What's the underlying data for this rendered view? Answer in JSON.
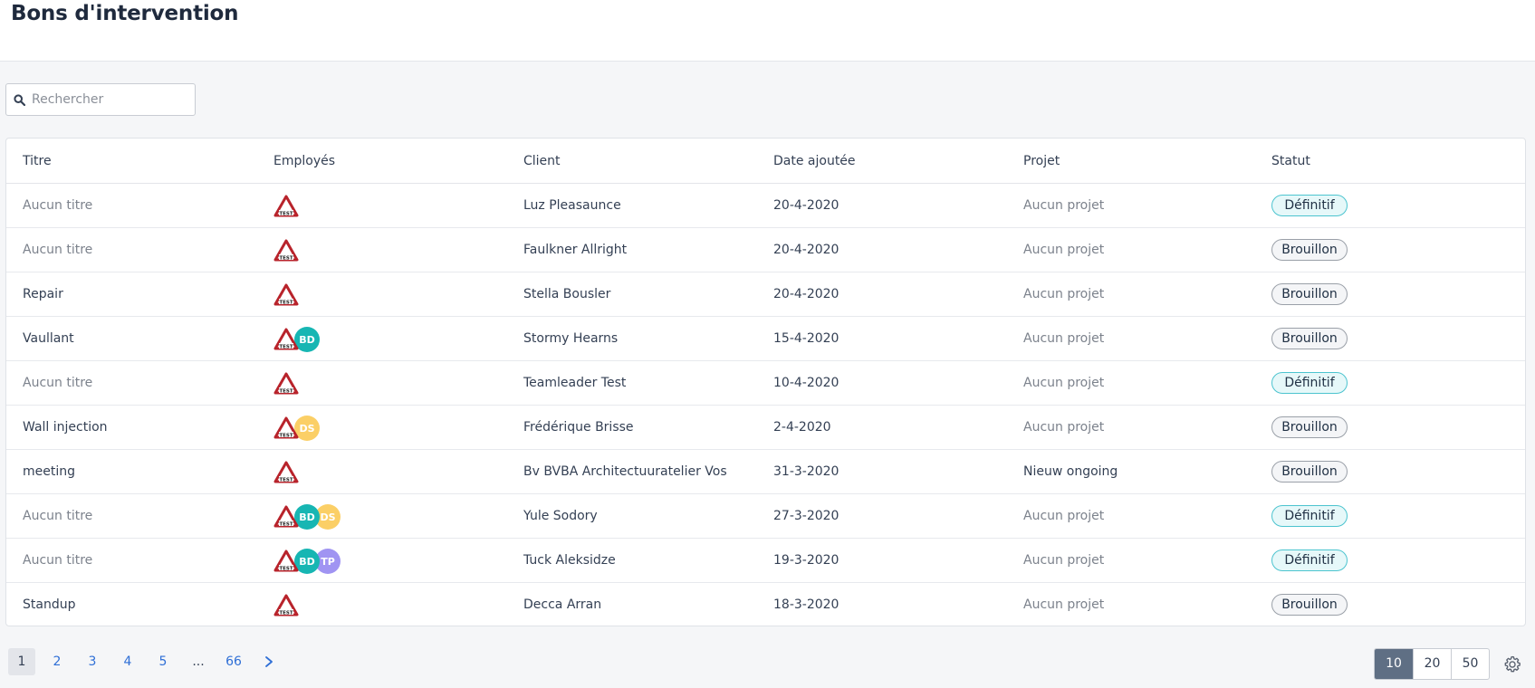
{
  "header": {
    "title": "Bons d'intervention"
  },
  "search": {
    "placeholder": "Rechercher",
    "icon": "search-icon"
  },
  "table": {
    "columns": [
      "Titre",
      "Employés",
      "Client",
      "Date ajoutée",
      "Projet",
      "Statut"
    ],
    "rows": [
      {
        "title": "Aucun titre",
        "title_muted": true,
        "employees": [
          "TEST"
        ],
        "client": "Luz Pleasaunce",
        "date": "20-4-2020",
        "project": "Aucun projet",
        "project_muted": true,
        "status": "Définitif",
        "status_kind": "def"
      },
      {
        "title": "Aucun titre",
        "title_muted": true,
        "employees": [
          "TEST"
        ],
        "client": "Faulkner Allright",
        "date": "20-4-2020",
        "project": "Aucun projet",
        "project_muted": true,
        "status": "Brouillon",
        "status_kind": "dra"
      },
      {
        "title": "Repair",
        "title_muted": false,
        "employees": [
          "TEST"
        ],
        "client": "Stella Bousler",
        "date": "20-4-2020",
        "project": "Aucun projet",
        "project_muted": true,
        "status": "Brouillon",
        "status_kind": "dra"
      },
      {
        "title": "Vaullant",
        "title_muted": false,
        "employees": [
          "TEST",
          "BD"
        ],
        "client": "Stormy Hearns",
        "date": "15-4-2020",
        "project": "Aucun projet",
        "project_muted": true,
        "status": "Brouillon",
        "status_kind": "dra"
      },
      {
        "title": "Aucun titre",
        "title_muted": true,
        "employees": [
          "TEST"
        ],
        "client": "Teamleader Test",
        "date": "10-4-2020",
        "project": "Aucun projet",
        "project_muted": true,
        "status": "Définitif",
        "status_kind": "def"
      },
      {
        "title": "Wall injection",
        "title_muted": false,
        "employees": [
          "TEST",
          "DS"
        ],
        "client": "Frédérique Brisse",
        "date": "2-4-2020",
        "project": "Aucun projet",
        "project_muted": true,
        "status": "Brouillon",
        "status_kind": "dra"
      },
      {
        "title": "meeting",
        "title_muted": false,
        "employees": [
          "TEST"
        ],
        "client": "Bv BVBA Architectuuratelier Vos",
        "date": "31-3-2020",
        "project": "Nieuw ongoing",
        "project_muted": false,
        "status": "Brouillon",
        "status_kind": "dra"
      },
      {
        "title": "Aucun titre",
        "title_muted": true,
        "employees": [
          "TEST",
          "BD",
          "DS"
        ],
        "client": "Yule Sodory",
        "date": "27-3-2020",
        "project": "Aucun projet",
        "project_muted": true,
        "status": "Définitif",
        "status_kind": "def"
      },
      {
        "title": "Aucun titre",
        "title_muted": true,
        "employees": [
          "TEST",
          "BD",
          "TP"
        ],
        "client": "Tuck Aleksidze",
        "date": "19-3-2020",
        "project": "Aucun projet",
        "project_muted": true,
        "status": "Définitif",
        "status_kind": "def"
      },
      {
        "title": "Standup",
        "title_muted": false,
        "employees": [
          "TEST"
        ],
        "client": "Decca Arran",
        "date": "18-3-2020",
        "project": "Aucun projet",
        "project_muted": true,
        "status": "Brouillon",
        "status_kind": "dra"
      }
    ]
  },
  "avatar_colors": {
    "BD": "#17b6b3",
    "DS": "#fbcf66",
    "TP": "#a094f2"
  },
  "pagination": {
    "pages": [
      "1",
      "2",
      "3",
      "4",
      "5",
      "...",
      "66"
    ],
    "current": "1",
    "next_icon": "chevron-right-icon"
  },
  "page_sizes": {
    "options": [
      "10",
      "20",
      "50"
    ],
    "selected": "10"
  },
  "settings": {
    "icon": "gear-icon"
  }
}
